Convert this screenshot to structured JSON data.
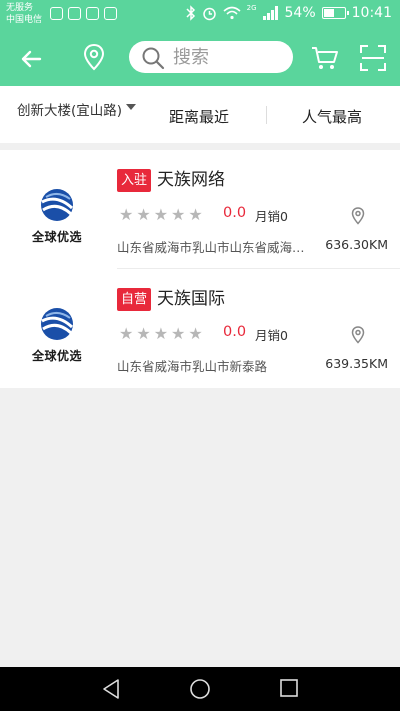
{
  "status_bar": {
    "carrier_line1": "无服务",
    "carrier_line2": "中国电信",
    "signal_label": "2G",
    "battery_percent": "54%",
    "battery_level": 0.54,
    "time": "10:41"
  },
  "header": {
    "back_icon": "back-arrow-icon",
    "location_icon": "location-pin-icon",
    "search_placeholder": "搜索",
    "cart_icon": "cart-icon",
    "scan_icon": "scan-icon",
    "bg_color": "#5ad59c"
  },
  "filters": {
    "location": "创新大楼(宜山路)",
    "sort_distance": "距离最近",
    "sort_popularity": "人气最高"
  },
  "shops": [
    {
      "tag": "入驻",
      "name": "天族网络",
      "logo_text": "全球优选",
      "stars": 5,
      "rating": "0.0",
      "sales": "月销0",
      "address": "山东省威海市乳山市山东省威海市乳山市",
      "distance": "636.30KM"
    },
    {
      "tag": "自营",
      "name": "天族国际",
      "logo_text": "全球优选",
      "stars": 5,
      "rating": "0.0",
      "sales": "月销0",
      "address": "山东省威海市乳山市新泰路",
      "distance": "639.35KM"
    }
  ],
  "accent_color": "#e8293b"
}
